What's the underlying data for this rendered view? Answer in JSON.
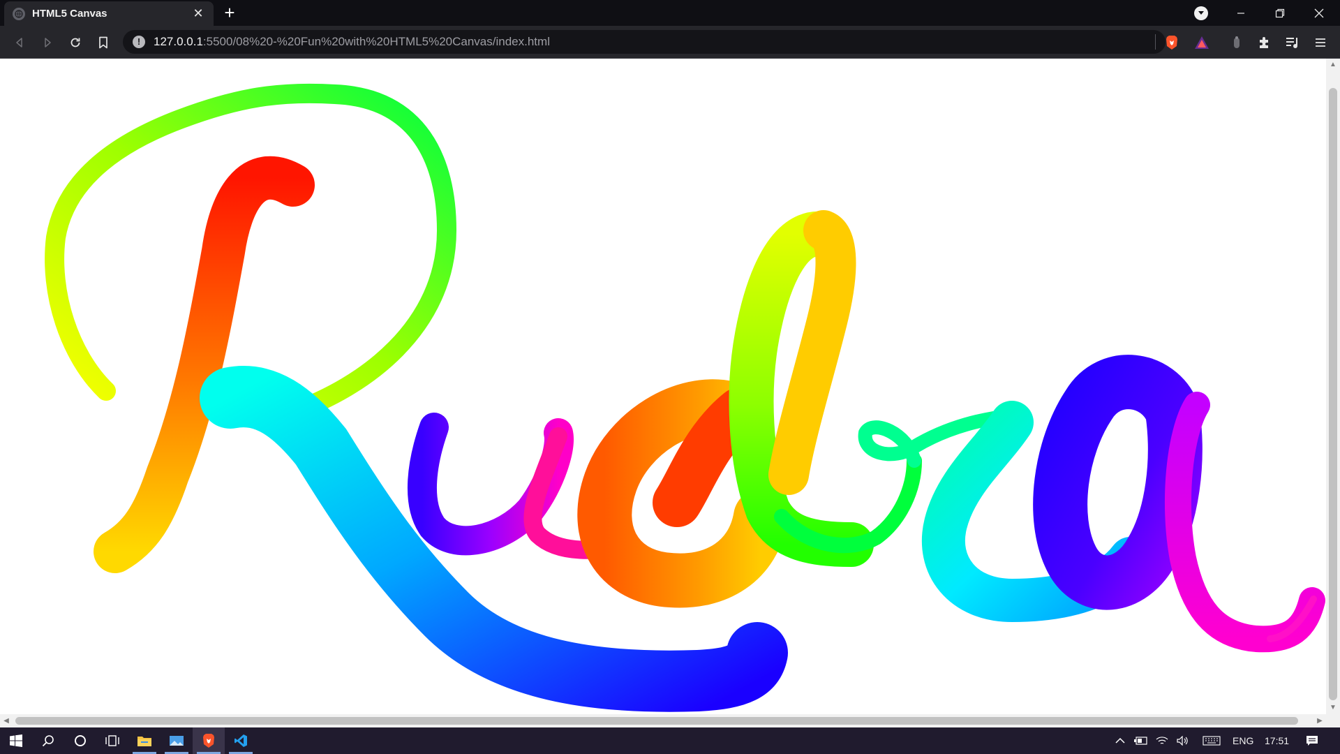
{
  "browser": {
    "tab": {
      "title": "HTML5 Canvas",
      "favicon": "globe-icon"
    },
    "address": {
      "host": "127.0.0.1",
      "path": ":5500/08%20-%20Fun%20with%20HTML5%20Canvas/index.html"
    },
    "colors": {
      "titlebar": "#0f0f14",
      "toolbar": "#26262b",
      "omnibox": "#141418",
      "brave": "#fb542b"
    }
  },
  "page": {
    "drawing": "Rudra",
    "colors": [
      "#ff0000",
      "#ff8000",
      "#ffff00",
      "#00ff00",
      "#00ffff",
      "#0000ff",
      "#8000ff",
      "#ff00ff"
    ]
  },
  "taskbar": {
    "language": "ENG",
    "time": "17:51",
    "apps": [
      "file-explorer-icon",
      "photos-icon",
      "brave-browser-icon",
      "vscode-icon"
    ]
  }
}
